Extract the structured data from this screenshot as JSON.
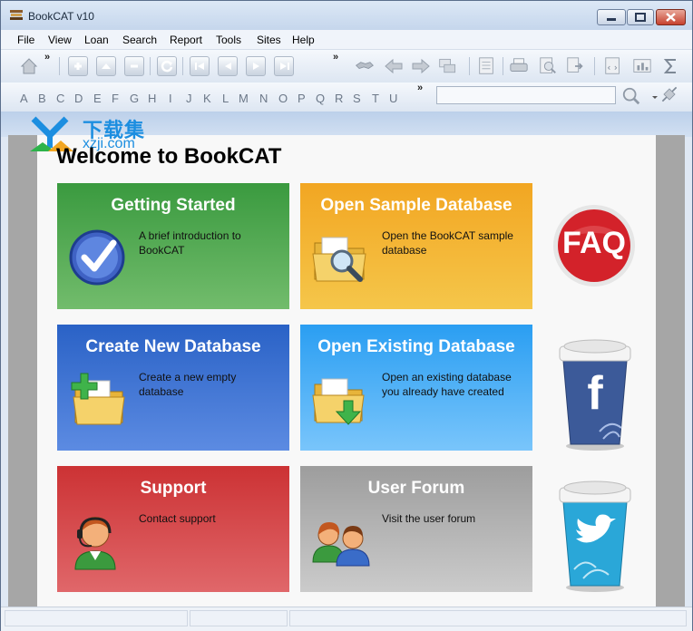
{
  "window": {
    "title": "BookCAT v10"
  },
  "menu": [
    "File",
    "View",
    "Loan",
    "Search",
    "Report",
    "Tools",
    "Sites",
    "Help"
  ],
  "toolbar": {
    "overflow_glyph": "»"
  },
  "alphabet": [
    "A",
    "B",
    "C",
    "D",
    "E",
    "F",
    "G",
    "H",
    "I",
    "J",
    "K",
    "L",
    "M",
    "N",
    "O",
    "P",
    "Q",
    "R",
    "S",
    "T",
    "U"
  ],
  "search": {
    "value": "",
    "placeholder": ""
  },
  "watermark": {
    "line1": "下载集",
    "line2": "xzji.com"
  },
  "welcome": {
    "title": "Welcome to BookCAT"
  },
  "tiles": [
    {
      "title": "Getting Started",
      "desc": "A brief introduction to BookCAT"
    },
    {
      "title": "Open Sample Database",
      "desc": "Open the BookCAT sample database"
    },
    {
      "title": "Create New Database",
      "desc": "Create a new empty database"
    },
    {
      "title": "Open Existing Database",
      "desc": "Open an existing database you already have created"
    },
    {
      "title": "Support",
      "desc": "Contact support"
    },
    {
      "title": "User Forum",
      "desc": "Visit the user forum"
    }
  ],
  "side": {
    "faq_label": "FAQ",
    "facebook_letter": "f"
  },
  "icons": [
    "home-icon",
    "add-icon",
    "up-icon",
    "remove-icon",
    "refresh-icon",
    "first-icon",
    "prev-icon",
    "next-icon",
    "last-icon",
    "loan-icon",
    "back-icon",
    "forward-icon",
    "windows-icon",
    "report-icon",
    "print-icon",
    "preview-icon",
    "export-icon",
    "html-icon",
    "chart-icon",
    "sum-icon",
    "search-icon",
    "connect-icon",
    "checkmark-icon",
    "folder-search-icon",
    "folder-add-icon",
    "folder-open-icon",
    "support-agent-icon",
    "users-icon",
    "faq-icon",
    "facebook-icon",
    "twitter-icon"
  ],
  "colors": {
    "green": "#3a9a3f",
    "orange": "#f2a622",
    "blue": "#2a62c6",
    "sky": "#2a9ef2",
    "red": "#cc3234",
    "gray": "#9d9d9d",
    "faq_red": "#d3222a"
  }
}
